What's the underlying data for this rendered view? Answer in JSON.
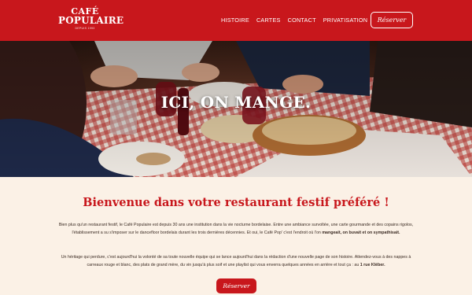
{
  "header": {
    "logo": {
      "line1": "CAFÉ",
      "line2": "POPULAIRE",
      "line3": "DEPUIS 1993"
    },
    "nav": [
      "HISTOIRE",
      "CARTES",
      "CONTACT",
      "PRIVATISATION"
    ],
    "reserve_label": "Réserver"
  },
  "hero": {
    "title": "ICI, ON MANGE."
  },
  "main": {
    "title": "Bienvenue dans votre restaurant festif préféré !",
    "p1_a": "Bien plus qu'un restaurant festif, le Café Populaire est depuis 30 ans une institution dans la vie nocturne bordelaise. Entre une ambiance survoltée, une carte gourmande et des copains rigolos, l'établissement a su s'imposer sur le dancefloor bordelais durant les trois dernières décennies. Et oui, le Café Pop' c'est l'endroit où l'on ",
    "p1_b": "mangeait, on buvait et on sympathisait.",
    "p2_a": "Un héritage qui perdure, c'est aujourd'hui la volonté de sa toute nouvelle équipe qui se lance aujourd'hui dans la rédaction d'une nouvelle page de son histoire. Attendez-vous à des nappes à carreaux rouge et blanc, des plats de grand mère, du vin jusqu'à plus soif et une playlist qui vous enverra quelques années en arrière et tout ça : au ",
    "p2_b": "1 rue Kléber.",
    "reserve_label": "Réserver"
  },
  "colors": {
    "brand_red": "#c8171c",
    "cream": "#fbf1e6"
  }
}
